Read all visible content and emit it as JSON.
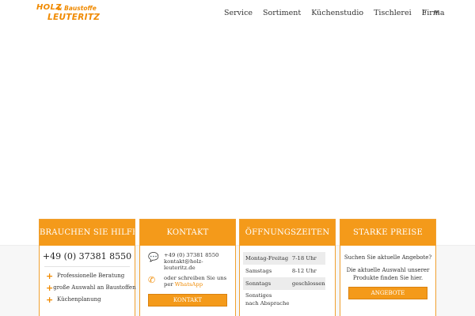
{
  "brand": {
    "logo_holz": "HOLZ",
    "logo_baustoffe": "& Baustoffe",
    "logo_leuteritz": "LEUTERITZ",
    "accent_color": "#f49a1a"
  },
  "nav": {
    "items": [
      "Service",
      "Sortiment",
      "Küchenstudio",
      "Tischlerei",
      "Firma"
    ],
    "icons": [
      "mobile-phone-icon",
      "envelope-icon"
    ]
  },
  "boxes": {
    "help": {
      "title": "BRAUCHEN SIE HILFE?",
      "phone": "+49 (0) 37381 8550",
      "features": [
        "Professionelle Beratung",
        "große Auswahl an Baustoffen",
        "Küchenplanung"
      ]
    },
    "contact": {
      "title": "KONTAKT",
      "phone": "+49 (0) 37381 8550",
      "email": "kontakt@holz-leuteritz.de",
      "email_line1": "kontakt@holz-",
      "email_line2": "leuteritz.de",
      "whatsapp_line1": "oder schreiben Sie uns",
      "whatsapp_prefix": "per ",
      "whatsapp_link": "WhatsApp",
      "button": "KONTAKT"
    },
    "hours": {
      "title": "ÖFFNUNGSZEITEN",
      "rows": [
        {
          "day": "Montag-Freitag",
          "time": "7-18 Uhr"
        },
        {
          "day": "Samstags",
          "time": "8-12 Uhr"
        },
        {
          "day": "Sonntags",
          "time": "geschlossen"
        },
        {
          "day_line1": "Sonstiges",
          "day_line2": "nach Absprache",
          "time": ""
        }
      ]
    },
    "offers": {
      "title": "STARKE PREISE",
      "text1": "Suchen Sie aktuelle Angebote?",
      "text2_line1": "Die aktuelle Auswahl unserer",
      "text2_line2": "Produkte finden Sie hier.",
      "button": "ANGEBOTE"
    }
  }
}
